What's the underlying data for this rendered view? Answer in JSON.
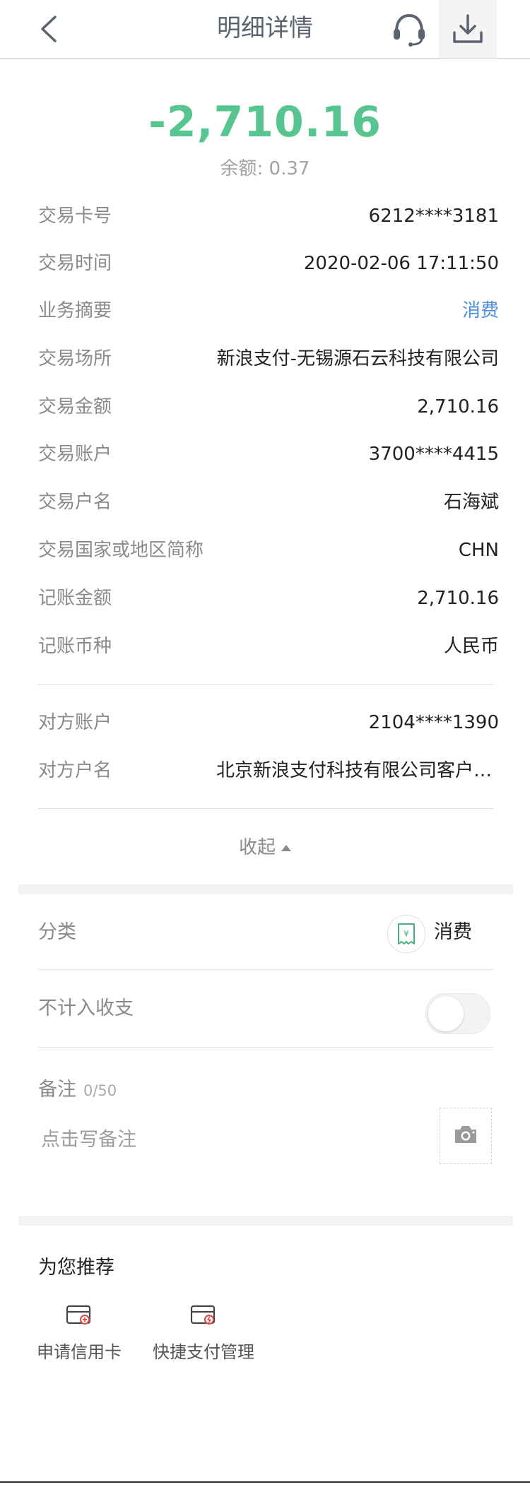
{
  "header": {
    "title": "明细详情"
  },
  "summary": {
    "amount": "-2,710.16",
    "balance": "余额: 0.37"
  },
  "details": [
    {
      "label": "交易卡号",
      "value": "6212****3181"
    },
    {
      "label": "交易时间",
      "value": "2020-02-06 17:11:50"
    },
    {
      "label": "业务摘要",
      "value": "消费",
      "is_link": true
    },
    {
      "label": "交易场所",
      "value": "新浪支付-无锡源石云科技有限公司"
    },
    {
      "label": "交易金额",
      "value": "2,710.16"
    },
    {
      "label": "交易账户",
      "value": "3700****4415"
    },
    {
      "label": "交易户名",
      "value": "石海斌"
    },
    {
      "label": "交易国家或地区简称",
      "value": "CHN"
    },
    {
      "label": "记账金额",
      "value": "2,710.16"
    },
    {
      "label": "记账币种",
      "value": "人民币"
    }
  ],
  "counterparty": [
    {
      "label": "对方账户",
      "value": "2104****1390"
    },
    {
      "label": "对方户名",
      "value": "北京新浪支付科技有限公司客户备付金"
    }
  ],
  "collapse_label": "收起",
  "category": {
    "label": "分类",
    "value": "消费",
    "icon": "receipt-yuan-icon"
  },
  "exclude": {
    "label": "不计入收支",
    "enabled": false
  },
  "note": {
    "label": "备注",
    "count": "0/50",
    "placeholder": "点击写备注"
  },
  "recommend": {
    "title": "为您推荐",
    "items": [
      {
        "label": "申请信用卡",
        "icon": "credit-card-add-icon"
      },
      {
        "label": "快捷支付管理",
        "icon": "quick-pay-card-icon"
      }
    ]
  },
  "colors": {
    "amount": "#57c58f",
    "link": "#4a8edc",
    "category_icon": "#4caf7d"
  }
}
